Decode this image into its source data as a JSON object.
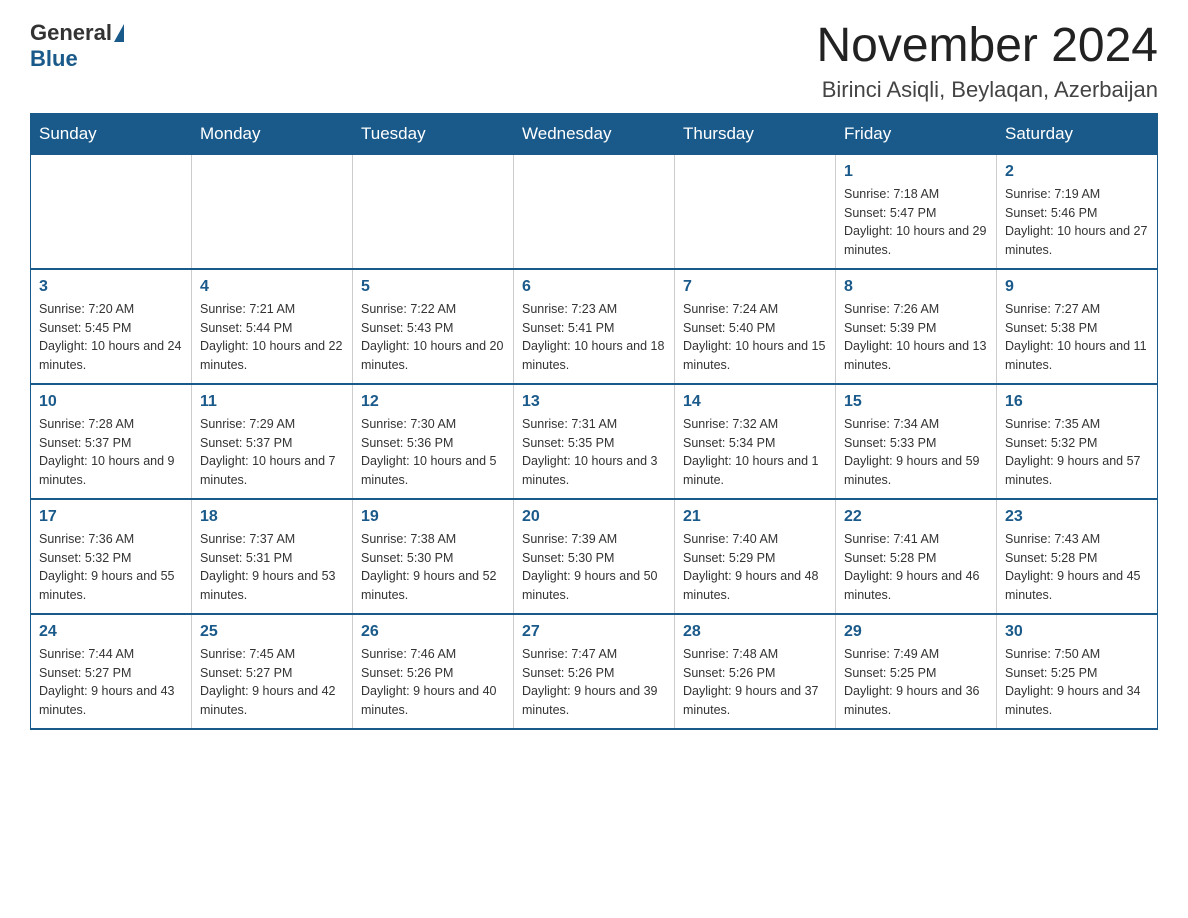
{
  "header": {
    "logo_general": "General",
    "logo_blue": "Blue",
    "month_title": "November 2024",
    "location": "Birinci Asiqli, Beylaqan, Azerbaijan"
  },
  "days_of_week": [
    "Sunday",
    "Monday",
    "Tuesday",
    "Wednesday",
    "Thursday",
    "Friday",
    "Saturday"
  ],
  "weeks": [
    [
      {
        "day": "",
        "info": ""
      },
      {
        "day": "",
        "info": ""
      },
      {
        "day": "",
        "info": ""
      },
      {
        "day": "",
        "info": ""
      },
      {
        "day": "",
        "info": ""
      },
      {
        "day": "1",
        "info": "Sunrise: 7:18 AM\nSunset: 5:47 PM\nDaylight: 10 hours and 29 minutes."
      },
      {
        "day": "2",
        "info": "Sunrise: 7:19 AM\nSunset: 5:46 PM\nDaylight: 10 hours and 27 minutes."
      }
    ],
    [
      {
        "day": "3",
        "info": "Sunrise: 7:20 AM\nSunset: 5:45 PM\nDaylight: 10 hours and 24 minutes."
      },
      {
        "day": "4",
        "info": "Sunrise: 7:21 AM\nSunset: 5:44 PM\nDaylight: 10 hours and 22 minutes."
      },
      {
        "day": "5",
        "info": "Sunrise: 7:22 AM\nSunset: 5:43 PM\nDaylight: 10 hours and 20 minutes."
      },
      {
        "day": "6",
        "info": "Sunrise: 7:23 AM\nSunset: 5:41 PM\nDaylight: 10 hours and 18 minutes."
      },
      {
        "day": "7",
        "info": "Sunrise: 7:24 AM\nSunset: 5:40 PM\nDaylight: 10 hours and 15 minutes."
      },
      {
        "day": "8",
        "info": "Sunrise: 7:26 AM\nSunset: 5:39 PM\nDaylight: 10 hours and 13 minutes."
      },
      {
        "day": "9",
        "info": "Sunrise: 7:27 AM\nSunset: 5:38 PM\nDaylight: 10 hours and 11 minutes."
      }
    ],
    [
      {
        "day": "10",
        "info": "Sunrise: 7:28 AM\nSunset: 5:37 PM\nDaylight: 10 hours and 9 minutes."
      },
      {
        "day": "11",
        "info": "Sunrise: 7:29 AM\nSunset: 5:37 PM\nDaylight: 10 hours and 7 minutes."
      },
      {
        "day": "12",
        "info": "Sunrise: 7:30 AM\nSunset: 5:36 PM\nDaylight: 10 hours and 5 minutes."
      },
      {
        "day": "13",
        "info": "Sunrise: 7:31 AM\nSunset: 5:35 PM\nDaylight: 10 hours and 3 minutes."
      },
      {
        "day": "14",
        "info": "Sunrise: 7:32 AM\nSunset: 5:34 PM\nDaylight: 10 hours and 1 minute."
      },
      {
        "day": "15",
        "info": "Sunrise: 7:34 AM\nSunset: 5:33 PM\nDaylight: 9 hours and 59 minutes."
      },
      {
        "day": "16",
        "info": "Sunrise: 7:35 AM\nSunset: 5:32 PM\nDaylight: 9 hours and 57 minutes."
      }
    ],
    [
      {
        "day": "17",
        "info": "Sunrise: 7:36 AM\nSunset: 5:32 PM\nDaylight: 9 hours and 55 minutes."
      },
      {
        "day": "18",
        "info": "Sunrise: 7:37 AM\nSunset: 5:31 PM\nDaylight: 9 hours and 53 minutes."
      },
      {
        "day": "19",
        "info": "Sunrise: 7:38 AM\nSunset: 5:30 PM\nDaylight: 9 hours and 52 minutes."
      },
      {
        "day": "20",
        "info": "Sunrise: 7:39 AM\nSunset: 5:30 PM\nDaylight: 9 hours and 50 minutes."
      },
      {
        "day": "21",
        "info": "Sunrise: 7:40 AM\nSunset: 5:29 PM\nDaylight: 9 hours and 48 minutes."
      },
      {
        "day": "22",
        "info": "Sunrise: 7:41 AM\nSunset: 5:28 PM\nDaylight: 9 hours and 46 minutes."
      },
      {
        "day": "23",
        "info": "Sunrise: 7:43 AM\nSunset: 5:28 PM\nDaylight: 9 hours and 45 minutes."
      }
    ],
    [
      {
        "day": "24",
        "info": "Sunrise: 7:44 AM\nSunset: 5:27 PM\nDaylight: 9 hours and 43 minutes."
      },
      {
        "day": "25",
        "info": "Sunrise: 7:45 AM\nSunset: 5:27 PM\nDaylight: 9 hours and 42 minutes."
      },
      {
        "day": "26",
        "info": "Sunrise: 7:46 AM\nSunset: 5:26 PM\nDaylight: 9 hours and 40 minutes."
      },
      {
        "day": "27",
        "info": "Sunrise: 7:47 AM\nSunset: 5:26 PM\nDaylight: 9 hours and 39 minutes."
      },
      {
        "day": "28",
        "info": "Sunrise: 7:48 AM\nSunset: 5:26 PM\nDaylight: 9 hours and 37 minutes."
      },
      {
        "day": "29",
        "info": "Sunrise: 7:49 AM\nSunset: 5:25 PM\nDaylight: 9 hours and 36 minutes."
      },
      {
        "day": "30",
        "info": "Sunrise: 7:50 AM\nSunset: 5:25 PM\nDaylight: 9 hours and 34 minutes."
      }
    ]
  ]
}
